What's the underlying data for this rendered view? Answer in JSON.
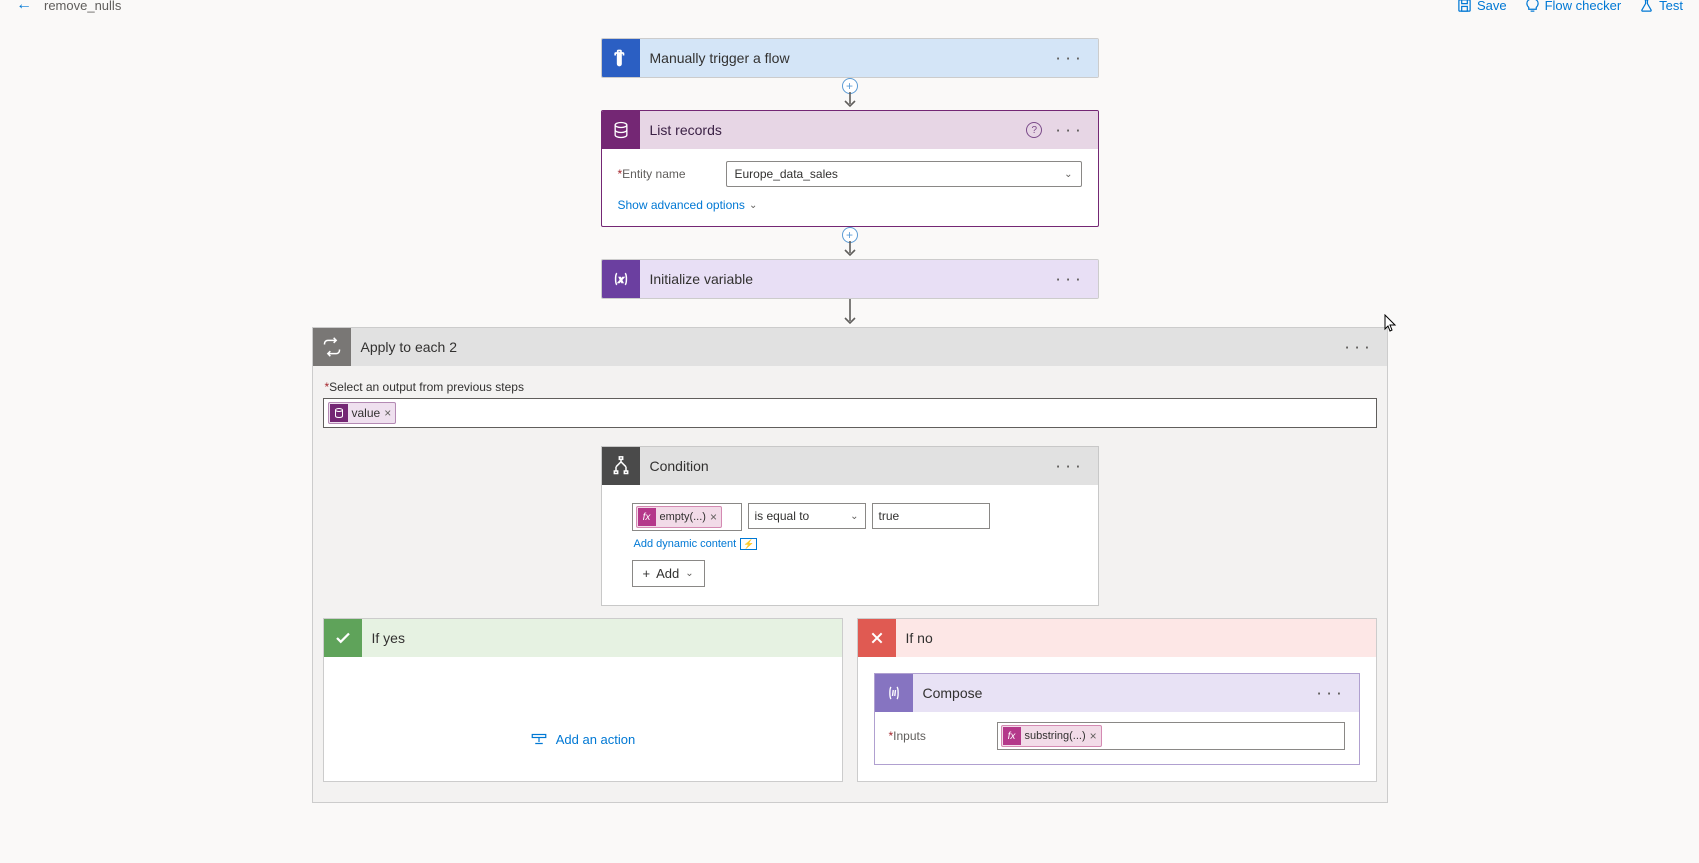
{
  "toolbar": {
    "flow_name": "remove_nulls",
    "save_label": "Save",
    "checker_label": "Flow checker",
    "test_label": "Test"
  },
  "trigger": {
    "title": "Manually trigger a flow"
  },
  "list_records": {
    "title": "List records",
    "entity_label": "Entity name",
    "entity_value": "Europe_data_sales",
    "advanced_label": "Show advanced options"
  },
  "init_var": {
    "title": "Initialize variable"
  },
  "apply": {
    "title": "Apply to each 2",
    "select_label": "Select an output from previous steps",
    "token_label": "value"
  },
  "condition": {
    "title": "Condition",
    "left_expr": "empty(...)",
    "operator": "is equal to",
    "right_value": "true",
    "dynamic_label": "Add dynamic content",
    "add_label": "Add"
  },
  "branches": {
    "yes_label": "If yes",
    "no_label": "If no",
    "add_action_label": "Add an action"
  },
  "compose": {
    "title": "Compose",
    "inputs_label": "Inputs",
    "expr_label": "substring(...)"
  }
}
